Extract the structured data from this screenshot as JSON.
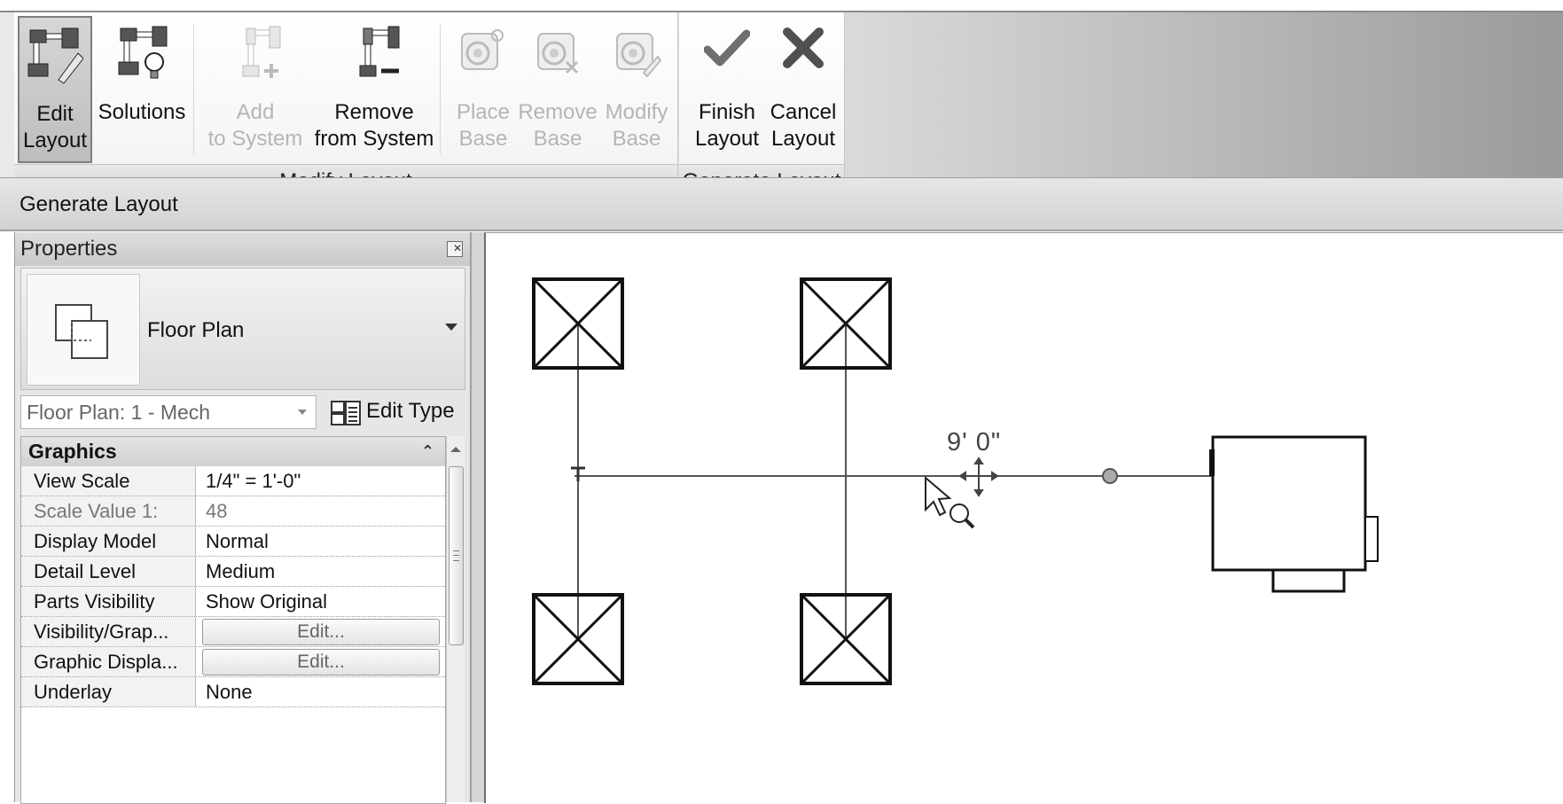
{
  "ribbon": {
    "buttons": {
      "edit_layout": [
        "Edit",
        "Layout"
      ],
      "solutions": [
        "Solutions"
      ],
      "add_to_system": [
        "Add",
        "to System"
      ],
      "remove_from_system": [
        "Remove",
        "from System"
      ],
      "place_base": [
        "Place",
        "Base"
      ],
      "remove_base": [
        "Remove",
        "Base"
      ],
      "modify_base": [
        "Modify",
        "Base"
      ],
      "finish_layout": [
        "Finish",
        "Layout"
      ],
      "cancel_layout": [
        "Cancel",
        "Layout"
      ]
    },
    "panels": {
      "modify_layout": "Modify Layout",
      "generate_layout": "Generate Layout"
    },
    "state": {
      "edit_layout_pressed": true,
      "disabled": [
        "Add to System",
        "Place Base",
        "Remove Base",
        "Modify Base"
      ]
    }
  },
  "options_bar": {
    "label": "Generate Layout"
  },
  "properties": {
    "title": "Properties",
    "type_selector": {
      "name": "Floor Plan"
    },
    "instance_selector": {
      "value": "Floor Plan: 1 - Mech"
    },
    "edit_type_label": "Edit Type",
    "group": "Graphics",
    "rows": [
      {
        "name": "View Scale",
        "value": "1/4\" = 1'-0\""
      },
      {
        "name": "Scale Value   1:",
        "value": "48"
      },
      {
        "name": "Display Model",
        "value": "Normal"
      },
      {
        "name": "Detail Level",
        "value": "Medium"
      },
      {
        "name": "Parts Visibility",
        "value": "Show Original"
      },
      {
        "name": "Visibility/Grap...",
        "value": "Edit..."
      },
      {
        "name": "Graphic Displa...",
        "value": "Edit..."
      },
      {
        "name": "Underlay",
        "value": "None"
      }
    ]
  },
  "canvas": {
    "dimension_label": "9'  0\"",
    "icons": [
      "air-terminal-icon",
      "air-terminal-icon",
      "air-terminal-icon",
      "air-terminal-icon",
      "equipment-icon",
      "move-cursor-icon",
      "zoom-cursor-icon"
    ]
  }
}
